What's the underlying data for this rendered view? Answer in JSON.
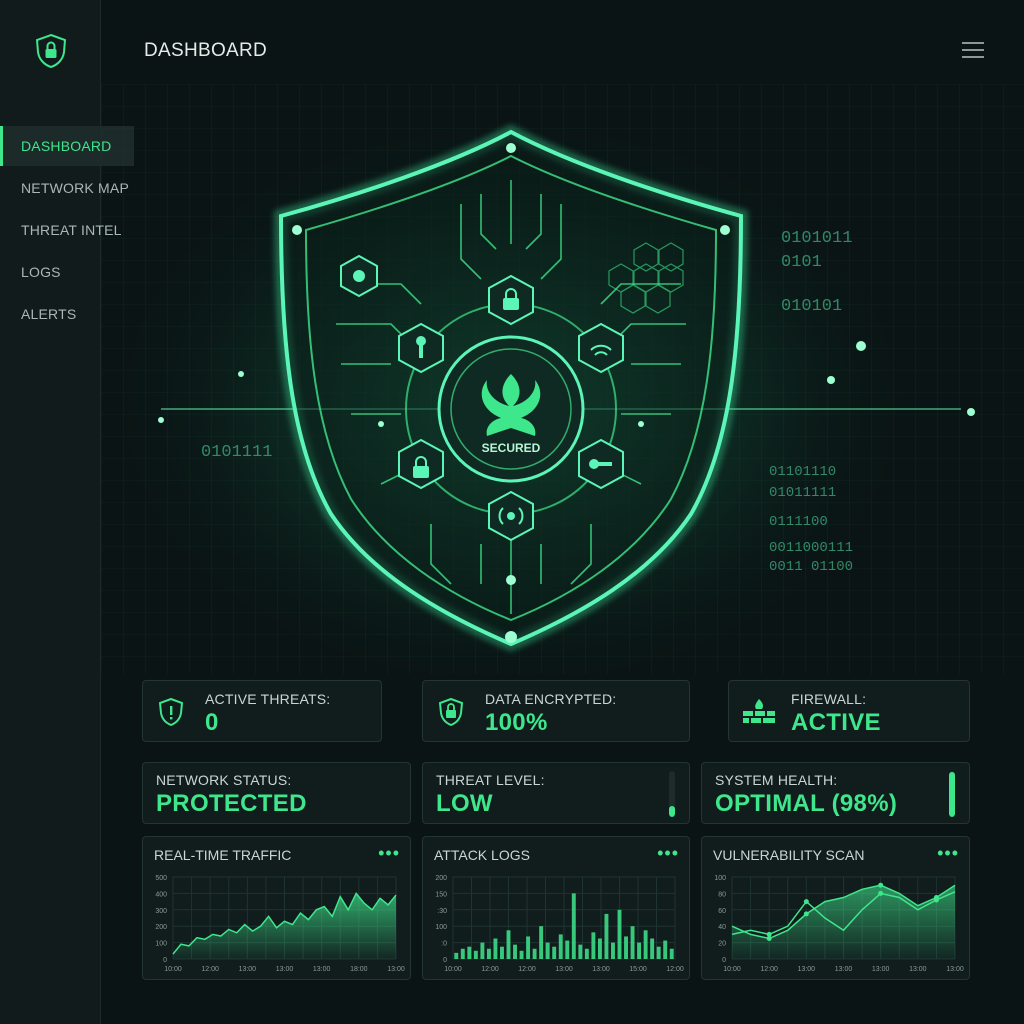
{
  "app": {
    "page_title": "DASHBOARD"
  },
  "sidebar": {
    "items": [
      {
        "label": "DASHBOARD",
        "active": true
      },
      {
        "label": "NETWORK MAP"
      },
      {
        "label": "THREAT INTEL"
      },
      {
        "label": "LOGS"
      },
      {
        "label": "ALERTS"
      }
    ]
  },
  "hero": {
    "shield_label": "SECURED",
    "binary": [
      "0101011",
      "0101",
      "010101",
      "0101111",
      "01101110",
      "01011111",
      "0111100",
      "0011000111",
      "0011 01100"
    ]
  },
  "stats": {
    "active_threats": {
      "label": "ACTIVE THREATS:",
      "value": "0"
    },
    "data_encrypted": {
      "label": "DATA ENCRYPTED:",
      "value": "100%"
    },
    "firewall": {
      "label": "FIREWALL:",
      "value": "ACTIVE"
    }
  },
  "status": {
    "network": {
      "label": "NETWORK STATUS:",
      "value": "PROTECTED"
    },
    "threat_level": {
      "label": "THREAT LEVEL:",
      "value": "LOW",
      "level": 0.25
    },
    "system_health": {
      "label": "SYSTEM HEALTH:",
      "value": "OPTIMAL (98%)",
      "level": 0.98
    }
  },
  "colors": {
    "accent": "#3ee68c",
    "background": "#0a1414",
    "card": "#111c1d"
  },
  "chart_data": [
    {
      "type": "area",
      "title": "REAL-TIME TRAFFIC",
      "x": [
        "10:00",
        "12:00",
        "13:00",
        "13:00",
        "13:00",
        "18:00",
        "13:00"
      ],
      "y_ticks": [
        "0",
        "100",
        "200",
        "300",
        "400",
        "500"
      ],
      "ylim": [
        0,
        500
      ],
      "values": [
        30,
        90,
        80,
        130,
        120,
        150,
        140,
        180,
        160,
        210,
        170,
        200,
        260,
        190,
        230,
        210,
        280,
        240,
        300,
        320,
        260,
        380,
        300,
        400,
        340,
        300,
        370,
        330,
        390
      ],
      "grid": true
    },
    {
      "type": "bar",
      "title": "ATTACK LOGS",
      "x": [
        "10:00",
        "12:00",
        "12:00",
        "13:00",
        "13:00",
        "15:00",
        "12:00"
      ],
      "y_ticks": [
        "0",
        ":0",
        "100",
        ":30",
        "150",
        "200"
      ],
      "ylim": [
        0,
        200
      ],
      "values": [
        15,
        25,
        30,
        20,
        40,
        25,
        50,
        30,
        70,
        35,
        20,
        55,
        25,
        80,
        40,
        30,
        60,
        45,
        160,
        35,
        25,
        65,
        50,
        110,
        40,
        120,
        55,
        80,
        40,
        70,
        50,
        30,
        45,
        25
      ],
      "grid": true
    },
    {
      "type": "line",
      "title": "VULNERABILITY SCAN",
      "x": [
        "10:00",
        "12:00",
        "13:00",
        "13:00",
        "13:00",
        "13:00",
        "13:00"
      ],
      "y_ticks": [
        "0",
        "20",
        "40",
        "60",
        "80",
        "100"
      ],
      "ylim": [
        0,
        100
      ],
      "series": [
        {
          "values": [
            40,
            30,
            25,
            35,
            55,
            70,
            75,
            85,
            90,
            80,
            65,
            75,
            90
          ]
        },
        {
          "values": [
            30,
            35,
            30,
            40,
            70,
            50,
            35,
            60,
            80,
            75,
            60,
            72,
            82
          ]
        }
      ],
      "grid": true
    }
  ]
}
